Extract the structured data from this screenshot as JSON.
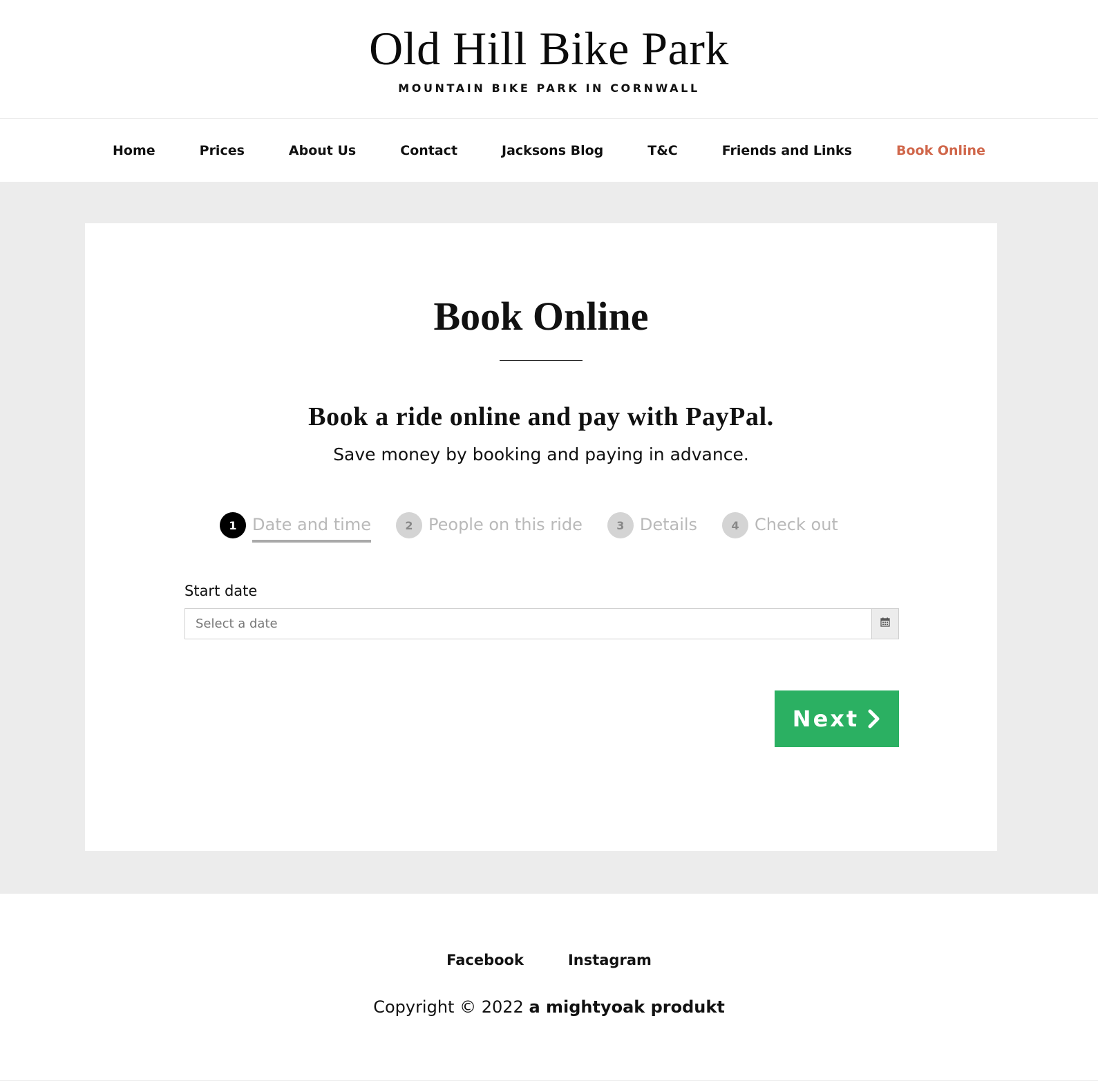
{
  "header": {
    "site_title": "Old Hill Bike Park",
    "tagline": "MOUNTAIN BIKE PARK IN CORNWALL"
  },
  "nav": {
    "items": [
      {
        "label": "Home"
      },
      {
        "label": "Prices"
      },
      {
        "label": "About Us"
      },
      {
        "label": "Contact"
      },
      {
        "label": "Jacksons Blog"
      },
      {
        "label": "T&C"
      },
      {
        "label": "Friends and Links"
      },
      {
        "label": "Book Online",
        "active": true
      }
    ]
  },
  "main": {
    "page_title": "Book Online",
    "lead": "Book a ride online and pay with PayPal.",
    "sublead": "Save money by booking and paying in advance.",
    "steps": [
      {
        "number": "1",
        "label": "Date and time",
        "active": true
      },
      {
        "number": "2",
        "label": "People on this ride"
      },
      {
        "number": "3",
        "label": "Details"
      },
      {
        "number": "4",
        "label": "Check out"
      }
    ],
    "form": {
      "start_date_label": "Start date",
      "start_date_placeholder": "Select a date",
      "start_date_value": "",
      "calendar_icon": "calendar-icon"
    },
    "next_label": "Next",
    "next_icon": "chevron-right-icon"
  },
  "footer": {
    "links": [
      {
        "label": "Facebook"
      },
      {
        "label": "Instagram"
      }
    ],
    "copyright_prefix": "Copyright © 2022",
    "copyright_brand": "a mightyoak produkt"
  },
  "colors": {
    "accent_nav_active": "#d0674b",
    "button_green": "#2bb062",
    "content_bg": "#ececec",
    "step_active": "#000000",
    "step_inactive": "#d4d4d4"
  }
}
